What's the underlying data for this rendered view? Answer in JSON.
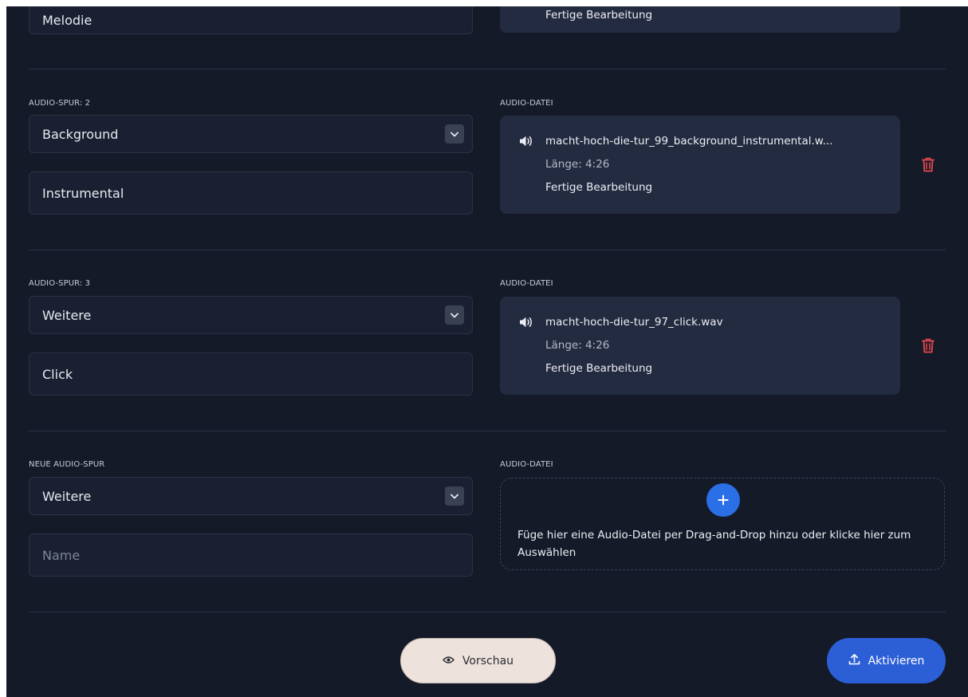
{
  "tracks": [
    {
      "type_label": "",
      "name_value": "Melodie",
      "file": {
        "status": "Fertige Bearbeitung"
      }
    },
    {
      "track_label": "AUDIO-SPUR: 2",
      "file_label": "AUDIO-DATEI",
      "type_value": "Background",
      "name_value": "Instrumental",
      "file": {
        "name": "macht-hoch-die-tur_99_background_instrumental.w...",
        "duration": "Länge: 4:26",
        "status": "Fertige Bearbeitung"
      }
    },
    {
      "track_label": "AUDIO-SPUR: 3",
      "file_label": "AUDIO-DATEI",
      "type_value": "Weitere",
      "name_value": "Click",
      "file": {
        "name": "macht-hoch-die-tur_97_click.wav",
        "duration": "Länge: 4:26",
        "status": "Fertige Bearbeitung"
      }
    }
  ],
  "new_track": {
    "track_label": "NEUE AUDIO-SPUR",
    "file_label": "AUDIO-DATEI",
    "type_value": "Weitere",
    "name_placeholder": "Name",
    "dropzone_text": "Füge hier eine Audio-Datei per Drag-and-Drop hinzu oder klicke hier zum Auswählen"
  },
  "footer": {
    "preview_label": "Vorschau",
    "activate_label": "Aktivieren"
  },
  "colors": {
    "background": "#151a28",
    "card": "#232b40",
    "field": "#1a2031",
    "accent_blue": "#2c5fd6",
    "delete_red": "#e5484d",
    "preview_button": "#ede2dc"
  },
  "icons": {
    "speaker": "speaker-icon",
    "delete": "trash-icon",
    "dropdown": "chevron-down-icon",
    "add": "plus-icon",
    "preview": "eye-icon",
    "activate": "upload-icon"
  }
}
